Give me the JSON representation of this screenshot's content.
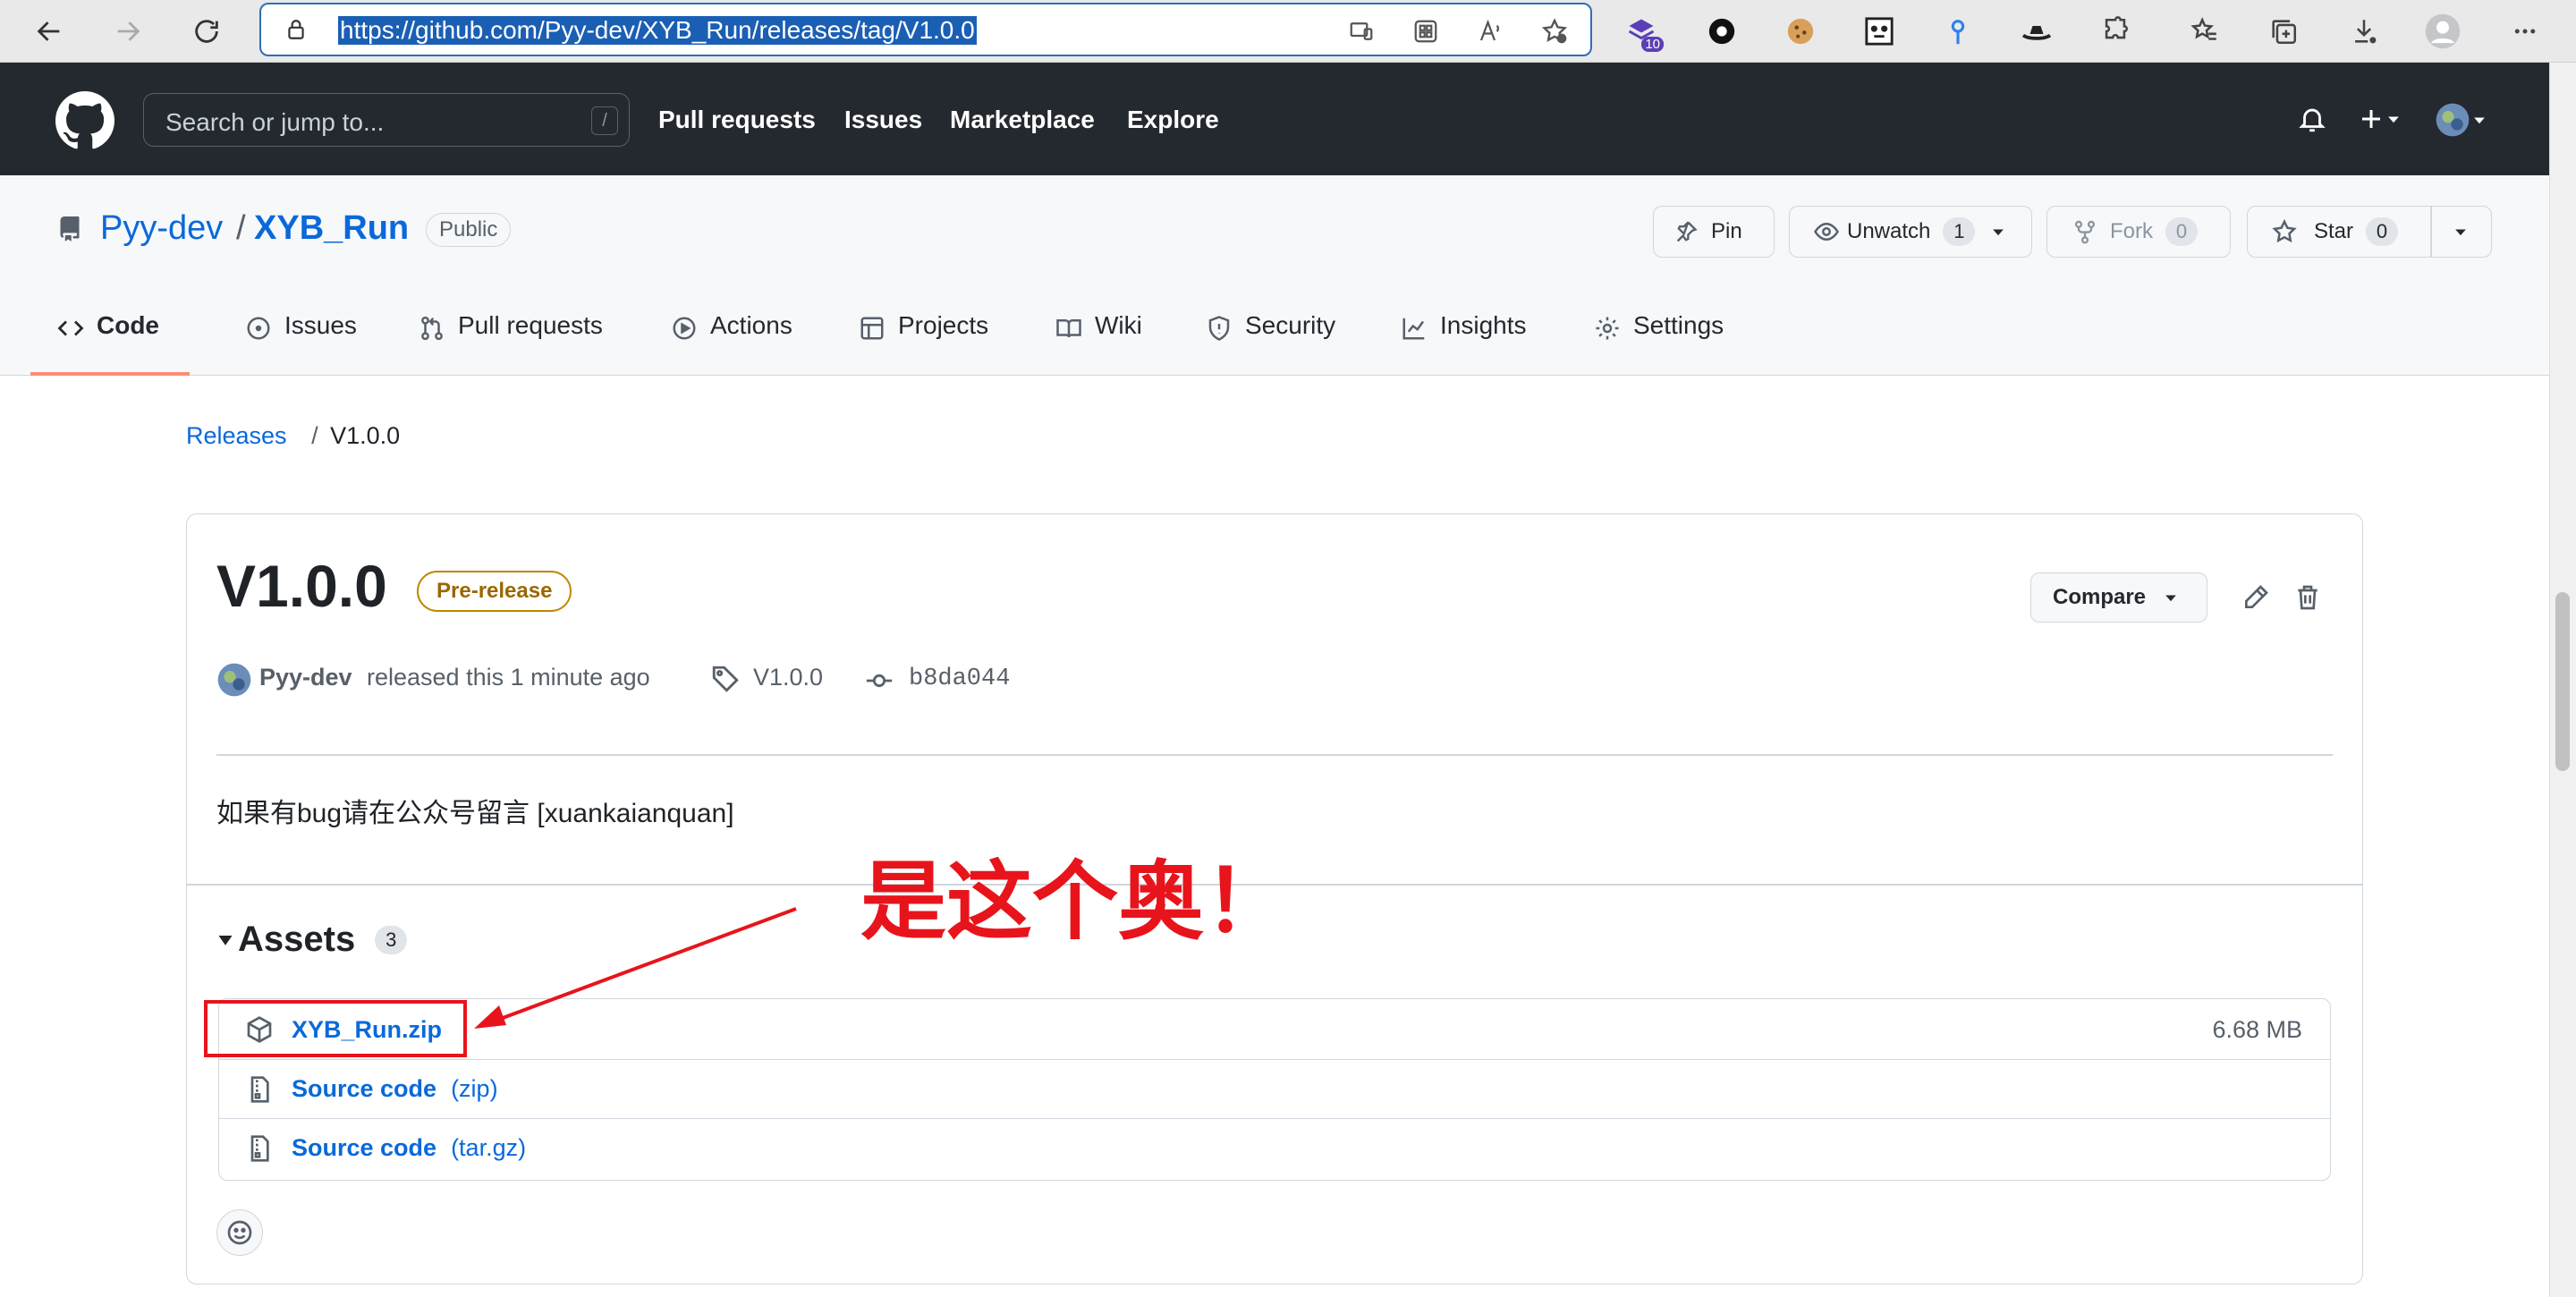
{
  "browser": {
    "url": "https://github.com/Pyy-dev/XYB_Run/releases/tag/V1.0.0",
    "extension_badge": "10"
  },
  "header": {
    "search_placeholder": "Search or jump to...",
    "search_shortcut": "/",
    "nav": [
      "Pull requests",
      "Issues",
      "Marketplace",
      "Explore"
    ]
  },
  "repo": {
    "owner": "Pyy-dev",
    "separator": "/",
    "name": "XYB_Run",
    "visibility": "Public",
    "pin_label": "Pin",
    "unwatch_label": "Unwatch",
    "watch_count": "1",
    "fork_label": "Fork",
    "fork_count": "0",
    "star_label": "Star",
    "star_count": "0",
    "tabs": [
      "Code",
      "Issues",
      "Pull requests",
      "Actions",
      "Projects",
      "Wiki",
      "Security",
      "Insights",
      "Settings"
    ]
  },
  "breadcrumb": {
    "releases": "Releases",
    "separator": "/",
    "current": "V1.0.0"
  },
  "release": {
    "title": "V1.0.0",
    "badge": "Pre-release",
    "compare_label": "Compare",
    "author": "Pyy-dev",
    "released_text": "released this 1 minute ago",
    "tag": "V1.0.0",
    "commit": "b8da044",
    "body": "如果有bug请在公众号留言 [xuankaianquan]",
    "assets_label": "Assets",
    "assets_count": "3",
    "assets": [
      {
        "name": "XYB_Run.zip",
        "sub": "",
        "size": "6.68 MB"
      },
      {
        "name": "Source code",
        "sub": "(zip)",
        "size": ""
      },
      {
        "name": "Source code",
        "sub": "(tar.gz)",
        "size": ""
      }
    ]
  },
  "annotation": {
    "text": "是这个奥！",
    "color": "#e8141c"
  },
  "colors": {
    "link": "#0969da",
    "header_bg": "#24292f",
    "prerelease": "#9a6700",
    "active_tab": "#fd8c73"
  }
}
